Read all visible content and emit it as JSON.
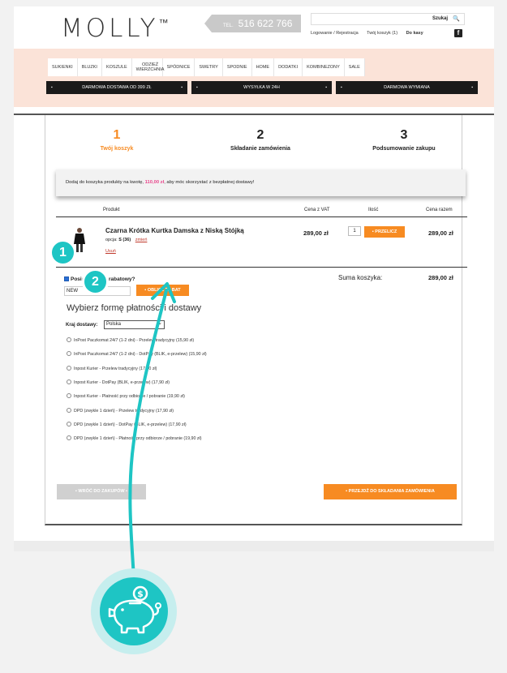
{
  "header": {
    "logo": "MOLLY",
    "logo_tm": "™",
    "phone_prefix": "TEL.",
    "phone": "516 622 766",
    "search_label": "Szukaj",
    "links": [
      "Logowanie / Rejestracja",
      "Twój koszyk (1)",
      "Do kasy"
    ]
  },
  "nav": [
    "SUKIENKI",
    "BLUZKI",
    "KOSZULE",
    "ODZIEŻ WIERZCHNIA",
    "SPÓDNICE",
    "SWETRY",
    "SPODNIE",
    "HOME",
    "DODATKI",
    "KOMBINEZONY",
    "SALE"
  ],
  "promos": [
    "DARMOWA DOSTAWA OD 399 ZŁ",
    "WYSYŁKA W 24H",
    "DARMOWA WYMIANA"
  ],
  "steps": [
    {
      "num": "1",
      "label": "Twój koszyk"
    },
    {
      "num": "2",
      "label": "Składanie zamówienia"
    },
    {
      "num": "3",
      "label": "Podsumowanie zakupu"
    }
  ],
  "notice": {
    "before": "Dodaj do koszyka produkty na kwotę,",
    "amount": "110,00 zł",
    "after": ", aby móc skorzystać z bezpłatnej dostawy!"
  },
  "table": {
    "headers": [
      "Produkt",
      "Cena z VAT",
      "Ilość",
      "Cena razem"
    ]
  },
  "product": {
    "name": "Czarna Krótka Kurtka Damska z Niską Stójką",
    "option_label": "opcja:",
    "option_value": "S (36)",
    "change": "zmień",
    "remove": "Usuń",
    "price": "289,00 zł",
    "qty": "1",
    "recalc": "PRZELICZ",
    "total": "289,00 zł"
  },
  "discount": {
    "label": "Posiadasz kod rabatowy?",
    "code": "NEW",
    "button": "OBLICZ RABAT"
  },
  "sum": {
    "label": "Suma koszyka:",
    "value": "289,00 zł"
  },
  "shipping": {
    "title": "Wybierz formę płatności i dostawy",
    "country_label": "Kraj dostawy:",
    "country": "Polska",
    "options": [
      "InPost Paczkomat 24/7 (1-2 dni) - Przelew tradycyjny (15,90 zł)",
      "InPost Paczkomat 24/7 (1-2 dni) - DotPay (BLIK, e-przelew) (15,90 zł)",
      "Inpost Kurier - Przelew tradycyjny (17,90 zł)",
      "Inpost Kurier - DotPay (BLIK, e-przelew) (17,90 zł)",
      "Inpost Kurier - Płatność przy odbiorze / pobranie (19,90 zł)",
      "DPD (zwykle 1 dzień) - Przelew tradycyjny (17,90 zł)",
      "DPD (zwykle 1 dzień) - DotPay (BLIK, e-przelew) (17,90 zł)",
      "DPD (zwykle 1 dzień) - Płatność przy odbiorze / pobranie (19,90 zł)"
    ]
  },
  "buttons": {
    "back": "WRÓĆ DO ZAKUPÓW",
    "next": "PRZEJDŹ DO SKŁADANIA ZAMÓWIENIA"
  },
  "badges": [
    "1",
    "2"
  ],
  "colors": {
    "accent": "#f78b22",
    "teal": "#1ec5c4",
    "pink": "#fbe3d8",
    "highlight": "#e8458b"
  }
}
